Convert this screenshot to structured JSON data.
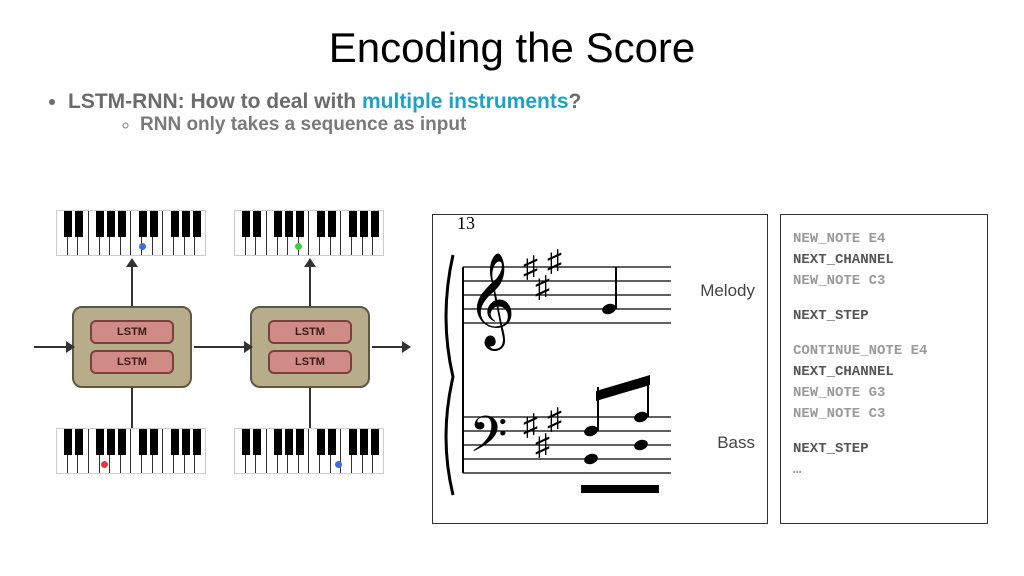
{
  "title": "Encoding the Score",
  "bullet1_a": "LSTM-RNN:  How to deal with ",
  "bullet1_b": "multiple instruments",
  "bullet1_c": "?",
  "bullet2": "RNN only takes a sequence as input",
  "lstm_label": "LSTM",
  "score": {
    "measure": "13",
    "melody_label": "Melody",
    "bass_label": "Bass"
  },
  "code": {
    "l1a": "NEW_NOTE ",
    "l1b": "E4",
    "l2": "NEXT_CHANNEL",
    "l3a": "NEW_NOTE ",
    "l3b": "C3",
    "l4": "NEXT_STEP",
    "l5a": "CONTINUE_NOTE ",
    "l5b": "E4",
    "l6": "NEXT_CHANNEL",
    "l7a": "NEW_NOTE ",
    "l7b": "G3",
    "l8a": "NEW_NOTE ",
    "l8b": "C3",
    "l9": "NEXT_STEP",
    "l10": "…"
  }
}
